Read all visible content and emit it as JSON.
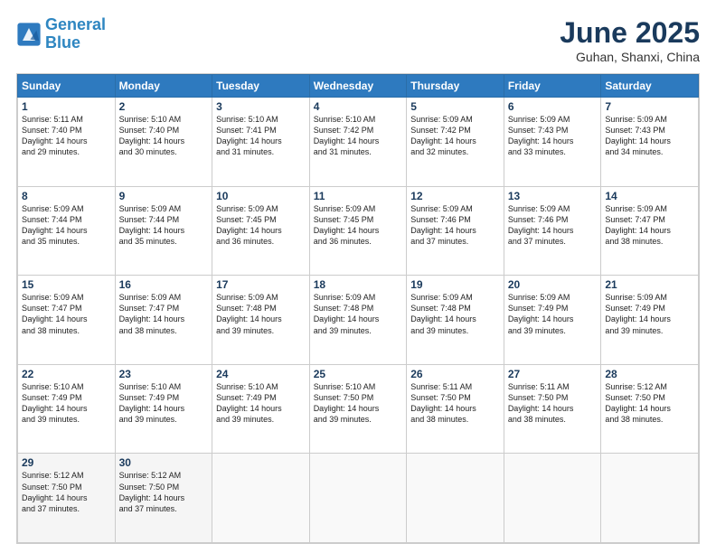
{
  "header": {
    "logo_line1": "General",
    "logo_line2": "Blue",
    "month": "June 2025",
    "location": "Guhan, Shanxi, China"
  },
  "days_of_week": [
    "Sunday",
    "Monday",
    "Tuesday",
    "Wednesday",
    "Thursday",
    "Friday",
    "Saturday"
  ],
  "weeks": [
    [
      {
        "num": "1",
        "info": "Sunrise: 5:11 AM\nSunset: 7:40 PM\nDaylight: 14 hours\nand 29 minutes."
      },
      {
        "num": "2",
        "info": "Sunrise: 5:10 AM\nSunset: 7:40 PM\nDaylight: 14 hours\nand 30 minutes."
      },
      {
        "num": "3",
        "info": "Sunrise: 5:10 AM\nSunset: 7:41 PM\nDaylight: 14 hours\nand 31 minutes."
      },
      {
        "num": "4",
        "info": "Sunrise: 5:10 AM\nSunset: 7:42 PM\nDaylight: 14 hours\nand 31 minutes."
      },
      {
        "num": "5",
        "info": "Sunrise: 5:09 AM\nSunset: 7:42 PM\nDaylight: 14 hours\nand 32 minutes."
      },
      {
        "num": "6",
        "info": "Sunrise: 5:09 AM\nSunset: 7:43 PM\nDaylight: 14 hours\nand 33 minutes."
      },
      {
        "num": "7",
        "info": "Sunrise: 5:09 AM\nSunset: 7:43 PM\nDaylight: 14 hours\nand 34 minutes."
      }
    ],
    [
      {
        "num": "8",
        "info": "Sunrise: 5:09 AM\nSunset: 7:44 PM\nDaylight: 14 hours\nand 35 minutes."
      },
      {
        "num": "9",
        "info": "Sunrise: 5:09 AM\nSunset: 7:44 PM\nDaylight: 14 hours\nand 35 minutes."
      },
      {
        "num": "10",
        "info": "Sunrise: 5:09 AM\nSunset: 7:45 PM\nDaylight: 14 hours\nand 36 minutes."
      },
      {
        "num": "11",
        "info": "Sunrise: 5:09 AM\nSunset: 7:45 PM\nDaylight: 14 hours\nand 36 minutes."
      },
      {
        "num": "12",
        "info": "Sunrise: 5:09 AM\nSunset: 7:46 PM\nDaylight: 14 hours\nand 37 minutes."
      },
      {
        "num": "13",
        "info": "Sunrise: 5:09 AM\nSunset: 7:46 PM\nDaylight: 14 hours\nand 37 minutes."
      },
      {
        "num": "14",
        "info": "Sunrise: 5:09 AM\nSunset: 7:47 PM\nDaylight: 14 hours\nand 38 minutes."
      }
    ],
    [
      {
        "num": "15",
        "info": "Sunrise: 5:09 AM\nSunset: 7:47 PM\nDaylight: 14 hours\nand 38 minutes."
      },
      {
        "num": "16",
        "info": "Sunrise: 5:09 AM\nSunset: 7:47 PM\nDaylight: 14 hours\nand 38 minutes."
      },
      {
        "num": "17",
        "info": "Sunrise: 5:09 AM\nSunset: 7:48 PM\nDaylight: 14 hours\nand 39 minutes."
      },
      {
        "num": "18",
        "info": "Sunrise: 5:09 AM\nSunset: 7:48 PM\nDaylight: 14 hours\nand 39 minutes."
      },
      {
        "num": "19",
        "info": "Sunrise: 5:09 AM\nSunset: 7:48 PM\nDaylight: 14 hours\nand 39 minutes."
      },
      {
        "num": "20",
        "info": "Sunrise: 5:09 AM\nSunset: 7:49 PM\nDaylight: 14 hours\nand 39 minutes."
      },
      {
        "num": "21",
        "info": "Sunrise: 5:09 AM\nSunset: 7:49 PM\nDaylight: 14 hours\nand 39 minutes."
      }
    ],
    [
      {
        "num": "22",
        "info": "Sunrise: 5:10 AM\nSunset: 7:49 PM\nDaylight: 14 hours\nand 39 minutes."
      },
      {
        "num": "23",
        "info": "Sunrise: 5:10 AM\nSunset: 7:49 PM\nDaylight: 14 hours\nand 39 minutes."
      },
      {
        "num": "24",
        "info": "Sunrise: 5:10 AM\nSunset: 7:49 PM\nDaylight: 14 hours\nand 39 minutes."
      },
      {
        "num": "25",
        "info": "Sunrise: 5:10 AM\nSunset: 7:50 PM\nDaylight: 14 hours\nand 39 minutes."
      },
      {
        "num": "26",
        "info": "Sunrise: 5:11 AM\nSunset: 7:50 PM\nDaylight: 14 hours\nand 38 minutes."
      },
      {
        "num": "27",
        "info": "Sunrise: 5:11 AM\nSunset: 7:50 PM\nDaylight: 14 hours\nand 38 minutes."
      },
      {
        "num": "28",
        "info": "Sunrise: 5:12 AM\nSunset: 7:50 PM\nDaylight: 14 hours\nand 38 minutes."
      }
    ],
    [
      {
        "num": "29",
        "info": "Sunrise: 5:12 AM\nSunset: 7:50 PM\nDaylight: 14 hours\nand 37 minutes."
      },
      {
        "num": "30",
        "info": "Sunrise: 5:12 AM\nSunset: 7:50 PM\nDaylight: 14 hours\nand 37 minutes."
      },
      {
        "num": "",
        "info": ""
      },
      {
        "num": "",
        "info": ""
      },
      {
        "num": "",
        "info": ""
      },
      {
        "num": "",
        "info": ""
      },
      {
        "num": "",
        "info": ""
      }
    ]
  ]
}
